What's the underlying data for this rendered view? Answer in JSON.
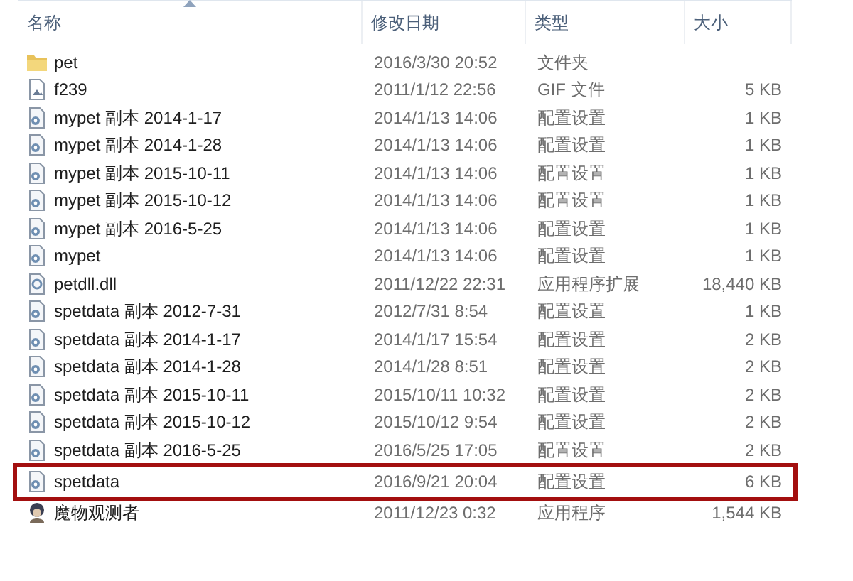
{
  "columns": [
    {
      "label": "名称",
      "sorted": true
    },
    {
      "label": "修改日期",
      "sorted": false
    },
    {
      "label": "类型",
      "sorted": false
    },
    {
      "label": "大小",
      "sorted": false
    }
  ],
  "files": [
    {
      "kind": "folder",
      "name": "pet",
      "modified": "2016/3/30 20:52",
      "type": "文件夹",
      "highlighted": false
    },
    {
      "kind": "image",
      "name": "f239",
      "modified": "2011/1/12 22:56",
      "type": "GIF 文件",
      "size": "5 KB",
      "highlighted": false
    },
    {
      "kind": "config",
      "name": "mypet 副本 2014-1-17",
      "modified": "2014/1/13 14:06",
      "type": "配置设置",
      "size": "1 KB",
      "highlighted": false
    },
    {
      "kind": "config",
      "name": "mypet 副本 2014-1-28",
      "modified": "2014/1/13 14:06",
      "type": "配置设置",
      "size": "1 KB",
      "highlighted": false
    },
    {
      "kind": "config",
      "name": "mypet 副本 2015-10-11",
      "modified": "2014/1/13 14:06",
      "type": "配置设置",
      "size": "1 KB",
      "highlighted": false
    },
    {
      "kind": "config",
      "name": "mypet 副本 2015-10-12",
      "modified": "2014/1/13 14:06",
      "type": "配置设置",
      "size": "1 KB",
      "highlighted": false
    },
    {
      "kind": "config",
      "name": "mypet 副本 2016-5-25",
      "modified": "2014/1/13 14:06",
      "type": "配置设置",
      "size": "1 KB",
      "highlighted": false
    },
    {
      "kind": "config",
      "name": "mypet",
      "modified": "2014/1/13 14:06",
      "type": "配置设置",
      "size": "1 KB",
      "highlighted": false
    },
    {
      "kind": "dll",
      "name": "petdll.dll",
      "modified": "2011/12/22 22:31",
      "type": "应用程序扩展",
      "size": "18,440 KB",
      "highlighted": false
    },
    {
      "kind": "config",
      "name": "spetdata 副本 2012-7-31",
      "modified": "2012/7/31 8:54",
      "type": "配置设置",
      "size": "1 KB",
      "highlighted": false
    },
    {
      "kind": "config",
      "name": "spetdata 副本 2014-1-17",
      "modified": "2014/1/17 15:54",
      "type": "配置设置",
      "size": "2 KB",
      "highlighted": false
    },
    {
      "kind": "config",
      "name": "spetdata 副本 2014-1-28",
      "modified": "2014/1/28 8:51",
      "type": "配置设置",
      "size": "2 KB",
      "highlighted": false
    },
    {
      "kind": "config",
      "name": "spetdata 副本 2015-10-11",
      "modified": "2015/10/11 10:32",
      "type": "配置设置",
      "size": "2 KB",
      "highlighted": false
    },
    {
      "kind": "config",
      "name": "spetdata 副本 2015-10-12",
      "modified": "2015/10/12 9:54",
      "type": "配置设置",
      "size": "2 KB",
      "highlighted": false
    },
    {
      "kind": "config",
      "name": "spetdata 副本 2016-5-25",
      "modified": "2016/5/25 17:05",
      "type": "配置设置",
      "size": "2 KB",
      "highlighted": false
    },
    {
      "kind": "config",
      "name": "spetdata",
      "modified": "2016/9/21 20:04",
      "type": "配置设置",
      "size": "6 KB",
      "highlighted": true
    },
    {
      "kind": "app",
      "name": "魔物观测者",
      "modified": "2011/12/23 0:32",
      "type": "应用程序",
      "size": "1,544 KB",
      "highlighted": false
    }
  ]
}
